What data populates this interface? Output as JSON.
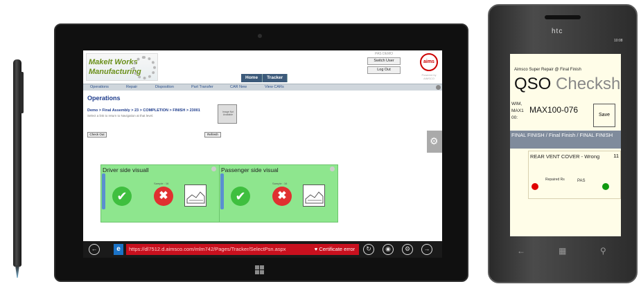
{
  "tablet": {
    "logo_line1": "MakeIt Works",
    "logo_line2": "Manufacturing",
    "user_name": "PAS DEMO",
    "switch_user": "Switch User",
    "log_out": "Log Out",
    "aims_logo": "aims",
    "powered_by": "Powered by AIMSCO",
    "nav": {
      "home": "Home",
      "tracker": "Tracker"
    },
    "menu": [
      "Operations",
      "Repair",
      "Disposition",
      "Part Transfer",
      "CAR New",
      "View CARs"
    ],
    "page_title": "Operations",
    "breadcrumb": "Demo > Final Assembly > 23 > COMPLETION > FINISH > 23001",
    "breadcrumb_hint": "Select a link to return to Navigation at that level.",
    "image_placeholder": "Image Not Available",
    "check_out": "Check Out",
    "refresh": "Refresh",
    "panels": [
      {
        "title": "Driver side visuall",
        "sample": "Sample : 16"
      },
      {
        "title": "Passenger side visual",
        "sample": "Sample : 16"
      }
    ],
    "address_url": "https://dl7512.d.aimsco.com/mlm742/Pages/Tracker/SelectPsn.aspx",
    "certificate": "Certificate error"
  },
  "phone": {
    "brand": "htc",
    "time": "10:08",
    "app_header": "Aimsco Super Repair @ Final Finish",
    "title_main": "QSO",
    "title_sub": "Checkshe",
    "wim_lines": [
      "WIM,",
      "MAX1",
      "00:"
    ],
    "part_number": "MAX100-076",
    "save": "Save",
    "path": "FINAL FINISH / Final Finish / FINAL FINISH",
    "item": "REAR VENT COVER - Wrong",
    "item_num": "11",
    "repaired": "Repaired Rs",
    "pas": "PAS"
  },
  "colors": {
    "accent_green": "#8ee68e",
    "address_red": "#c8101e",
    "nav_blue": "#3c5a7a",
    "phone_bar": "#7f8b9c"
  },
  "icons": [
    "back-icon",
    "ie-icon",
    "lock-icon",
    "refresh-icon",
    "pin-icon",
    "tools-icon",
    "forward-icon",
    "gear-icon",
    "check-icon",
    "cross-icon",
    "windows-icon"
  ]
}
